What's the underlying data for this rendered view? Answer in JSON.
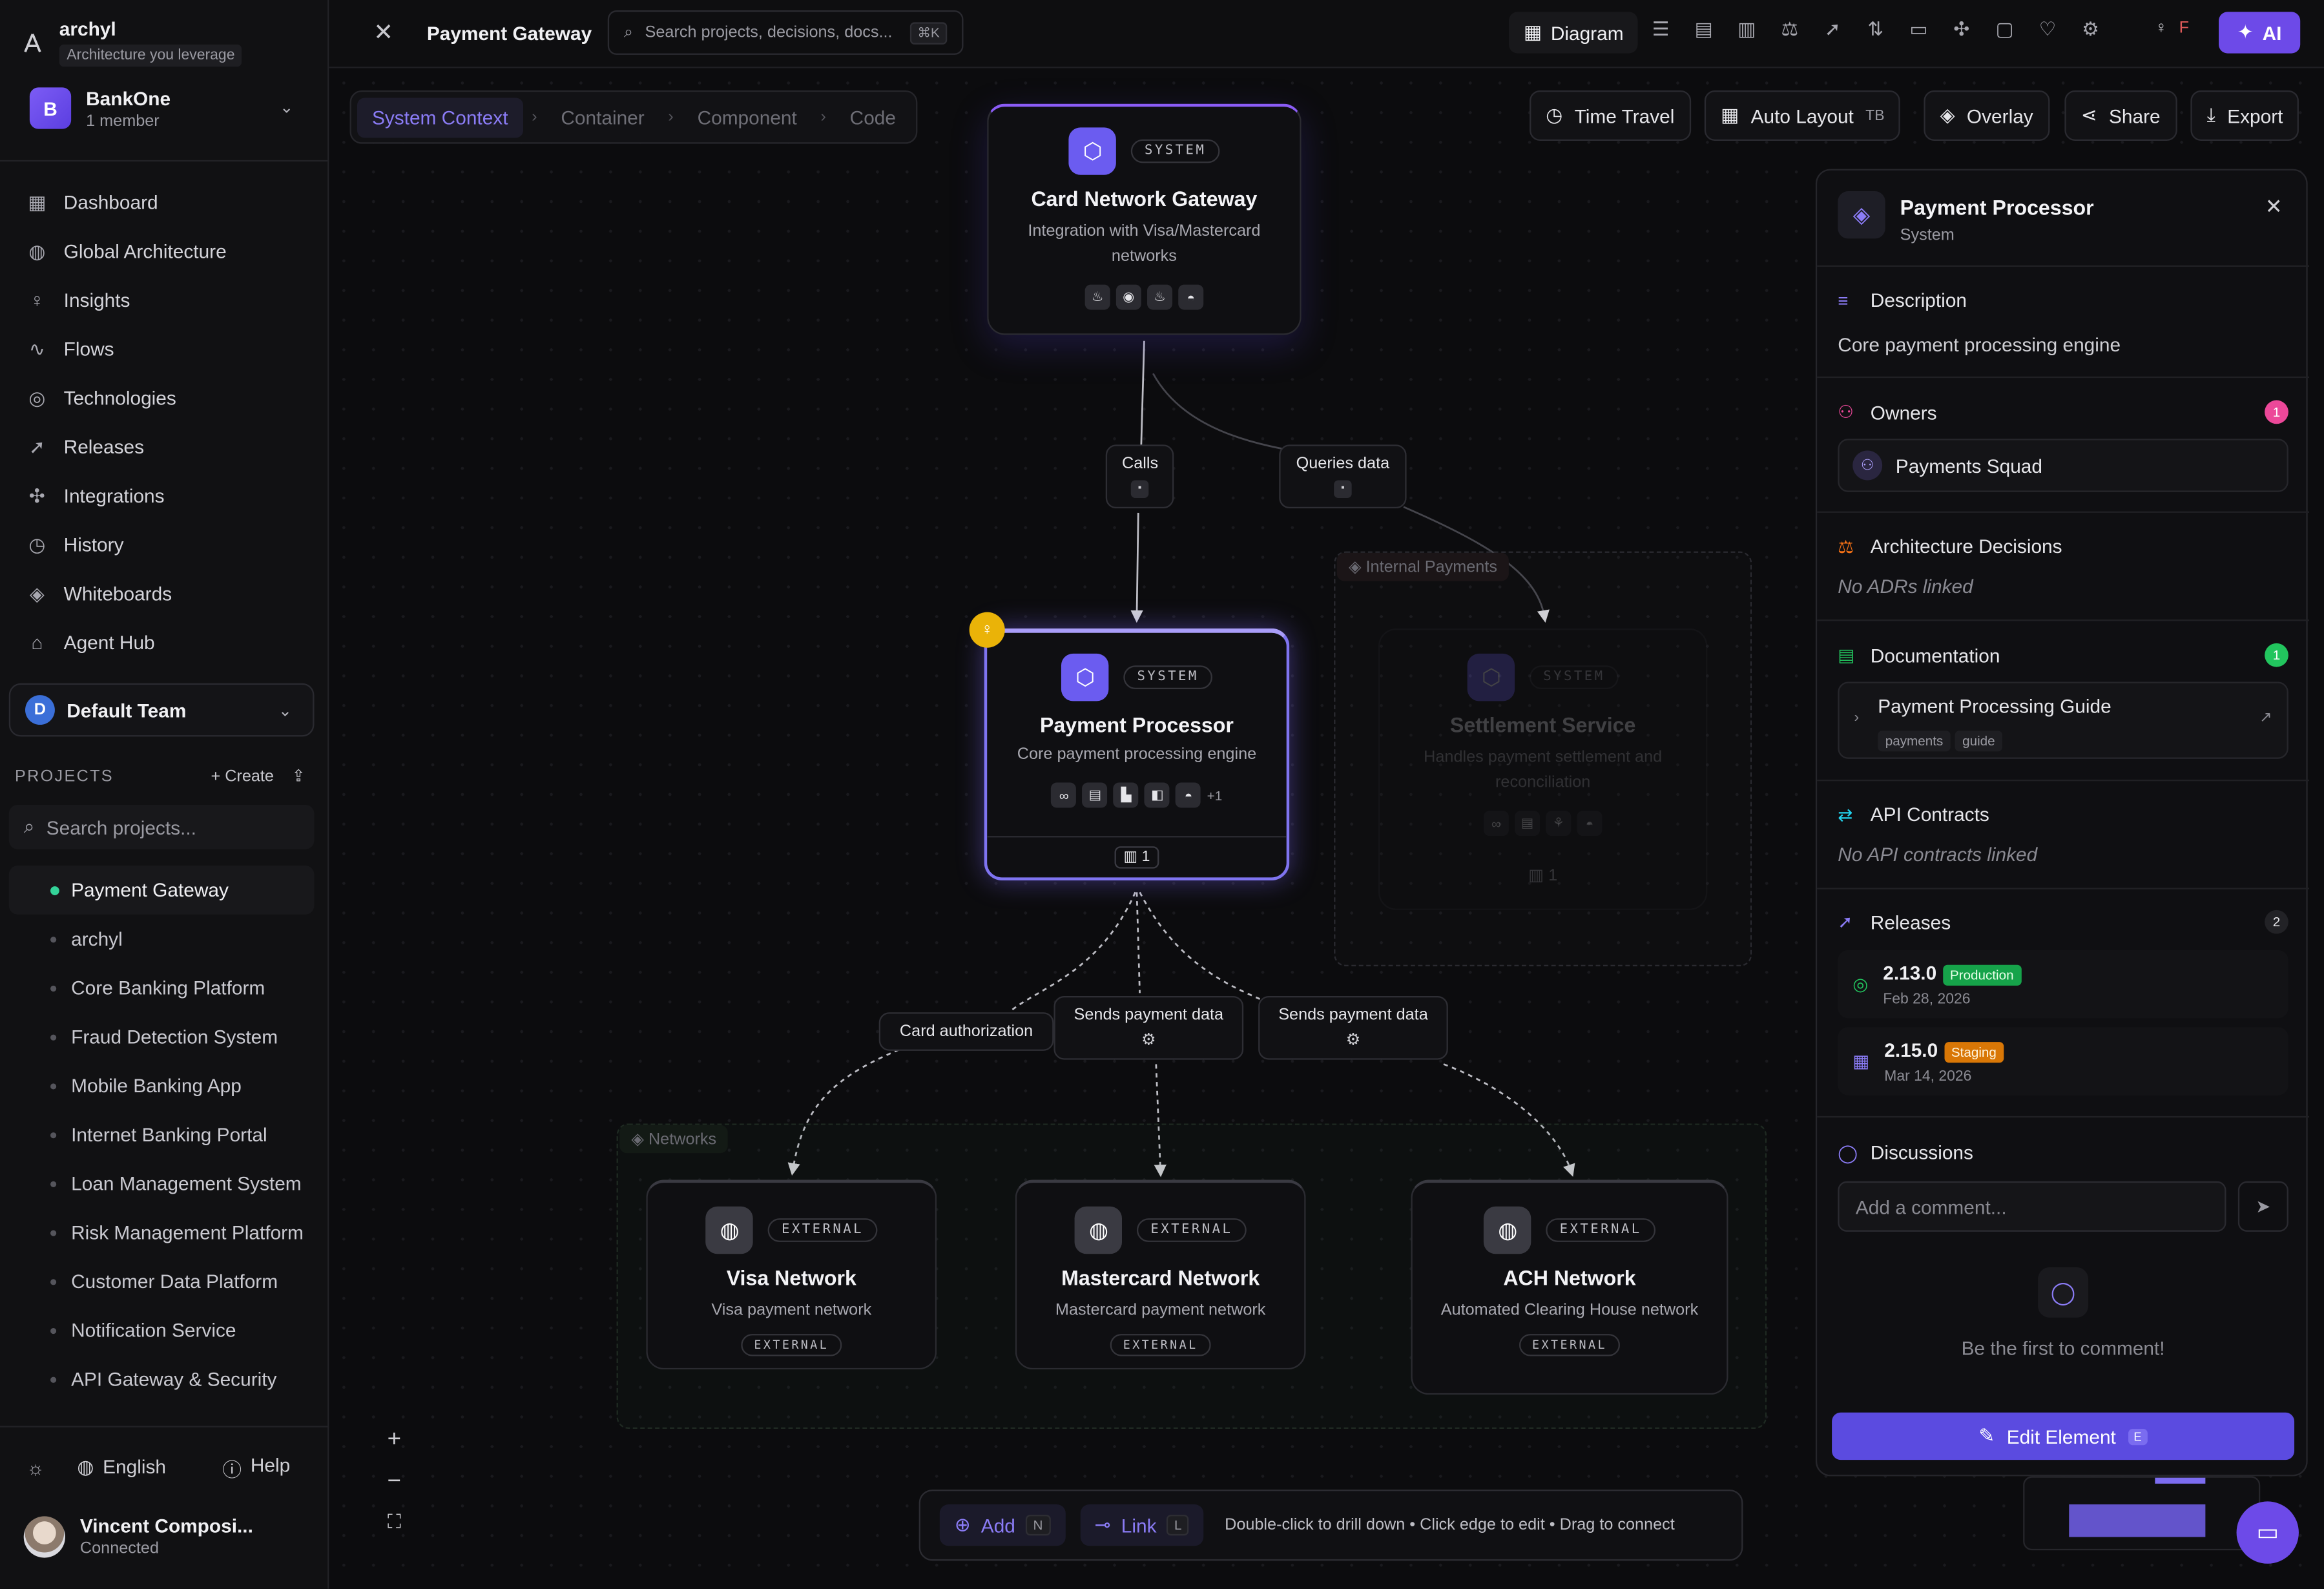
{
  "app": {
    "name": "archyl",
    "tagline": "Architecture you leverage"
  },
  "workspace": {
    "initial": "B",
    "name": "BankOne",
    "members": "1 member"
  },
  "nav": [
    {
      "label": "Dashboard",
      "icon": "grid-icon"
    },
    {
      "label": "Global Architecture",
      "icon": "globe-icon"
    },
    {
      "label": "Insights",
      "icon": "lightbulb-icon"
    },
    {
      "label": "Flows",
      "icon": "activity-icon"
    },
    {
      "label": "Technologies",
      "icon": "target-icon"
    },
    {
      "label": "Releases",
      "icon": "rocket-icon"
    },
    {
      "label": "Integrations",
      "icon": "puzzle-icon"
    },
    {
      "label": "History",
      "icon": "clock-icon"
    },
    {
      "label": "Whiteboards",
      "icon": "layers-icon"
    },
    {
      "label": "Agent Hub",
      "icon": "bot-icon"
    }
  ],
  "team": {
    "initial": "D",
    "name": "Default Team"
  },
  "projects": {
    "heading": "PROJECTS",
    "create_label": "Create",
    "search_placeholder": "Search projects...",
    "items": [
      "Payment Gateway",
      "archyl",
      "Core Banking Platform",
      "Fraud Detection System",
      "Mobile Banking App",
      "Internet Banking Portal",
      "Loan Management System",
      "Risk Management Platform",
      "Customer Data Platform",
      "Notification Service",
      "API Gateway & Security"
    ],
    "active": "Payment Gateway"
  },
  "footer": {
    "language": "English",
    "help": "Help"
  },
  "user": {
    "name": "Vincent Composi...",
    "status": "Connected"
  },
  "topbar": {
    "title": "Payment Gateway",
    "search_placeholder": "Search projects, decisions, docs...",
    "search_shortcut": "⌘K",
    "view_label": "Diagram",
    "user_initial": "F",
    "ai_label": "AI"
  },
  "breadcrumb": [
    "System Context",
    "Container",
    "Component",
    "Code"
  ],
  "canvas_buttons": {
    "time_travel": "Time Travel",
    "auto_layout": "Auto Layout",
    "auto_layout_dir": "TB",
    "overlay": "Overlay",
    "share": "Share",
    "export": "Export"
  },
  "groups": {
    "internal": "Internal Payments",
    "networks": "Networks"
  },
  "nodes": {
    "card_network": {
      "type": "SYSTEM",
      "title": "Card Network Gateway",
      "desc": "Integration with Visa/Mastercard networks"
    },
    "payment_processor": {
      "type": "SYSTEM",
      "title": "Payment Processor",
      "desc": "Core payment processing engine",
      "more": "+1",
      "docs": "1"
    },
    "settlement": {
      "type": "SYSTEM",
      "title": "Settlement Service",
      "desc": "Handles payment settlement and reconciliation",
      "docs": "1"
    },
    "visa": {
      "type": "EXTERNAL",
      "title": "Visa Network",
      "desc": "Visa payment network",
      "tag": "EXTERNAL"
    },
    "mastercard": {
      "type": "EXTERNAL",
      "title": "Mastercard Network",
      "desc": "Mastercard payment network",
      "tag": "EXTERNAL"
    },
    "ach": {
      "type": "EXTERNAL",
      "title": "ACH Network",
      "desc": "Automated Clearing House network",
      "tag": "EXTERNAL"
    }
  },
  "edges": {
    "calls": "Calls",
    "queries": "Queries data",
    "card_auth": "Card authorization",
    "sends1": "Sends payment data",
    "sends2": "Sends payment data"
  },
  "bottom_bar": {
    "add_label": "Add",
    "add_key": "N",
    "link_label": "Link",
    "link_key": "L",
    "hint": "Double-click to drill down • Click edge to edit • Drag to connect"
  },
  "panel": {
    "title": "Payment Processor",
    "subtitle": "System",
    "description_h": "Description",
    "description": "Core payment processing engine",
    "owners_h": "Owners",
    "owners_count": "1",
    "owner": "Payments Squad",
    "adr_h": "Architecture Decisions",
    "adr_empty": "No ADRs linked",
    "docs_h": "Documentation",
    "docs_count": "1",
    "doc_title": "Payment Processing Guide",
    "doc_tags": [
      "payments",
      "guide"
    ],
    "api_h": "API Contracts",
    "api_empty": "No API contracts linked",
    "releases_h": "Releases",
    "releases_count": "2",
    "releases": [
      {
        "version": "2.13.0",
        "env": "Production",
        "date": "Feb 28, 2026"
      },
      {
        "version": "2.15.0",
        "env": "Staging",
        "date": "Mar 14, 2026"
      }
    ],
    "discussions_h": "Discussions",
    "comment_placeholder": "Add a comment...",
    "empty_comments": "Be the first to comment!",
    "edit_label": "Edit Element",
    "edit_key": "E"
  },
  "colors": {
    "accent": "#6d4ae8",
    "production": "#22c55e",
    "staging": "#f59e0b",
    "owners_badge": "#ec4899",
    "docs_badge": "#22c55e"
  }
}
